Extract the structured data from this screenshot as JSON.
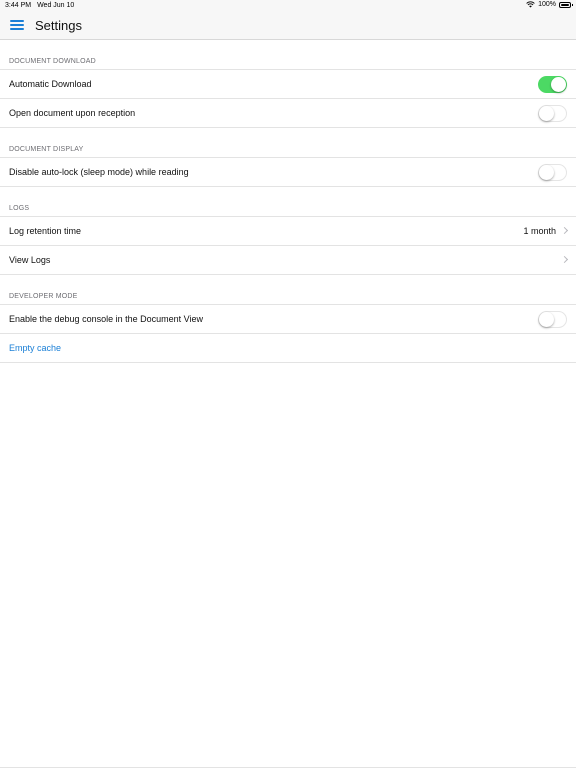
{
  "status_bar": {
    "time": "3:44 PM",
    "date": "Wed Jun 10",
    "battery_percent": "100%",
    "wifi_icon": "wifi-icon",
    "battery_icon": "battery-icon"
  },
  "nav": {
    "title": "Settings",
    "menu_icon": "hamburger-menu-icon",
    "accent_color": "#1a7fd6"
  },
  "sections": {
    "document_download": {
      "header": "DOCUMENT DOWNLOAD",
      "rows": [
        {
          "label": "Automatic Download",
          "toggle_on": true
        },
        {
          "label": "Open document upon reception",
          "toggle_on": false
        }
      ]
    },
    "document_display": {
      "header": "DOCUMENT DISPLAY",
      "rows": [
        {
          "label": "Disable auto-lock (sleep mode) while reading",
          "toggle_on": false
        }
      ]
    },
    "logs": {
      "header": "LOGS",
      "rows": [
        {
          "label": "Log retention time",
          "value": "1 month"
        },
        {
          "label": "View Logs"
        }
      ]
    },
    "developer_mode": {
      "header": "DEVELOPER MODE",
      "rows": [
        {
          "label": "Enable the debug console in the Document View",
          "toggle_on": false
        },
        {
          "label": "Empty cache"
        }
      ]
    }
  },
  "colors": {
    "toggle_on": "#4cd964",
    "link": "#1a7fd6",
    "section_header_text": "#6d6d72"
  }
}
